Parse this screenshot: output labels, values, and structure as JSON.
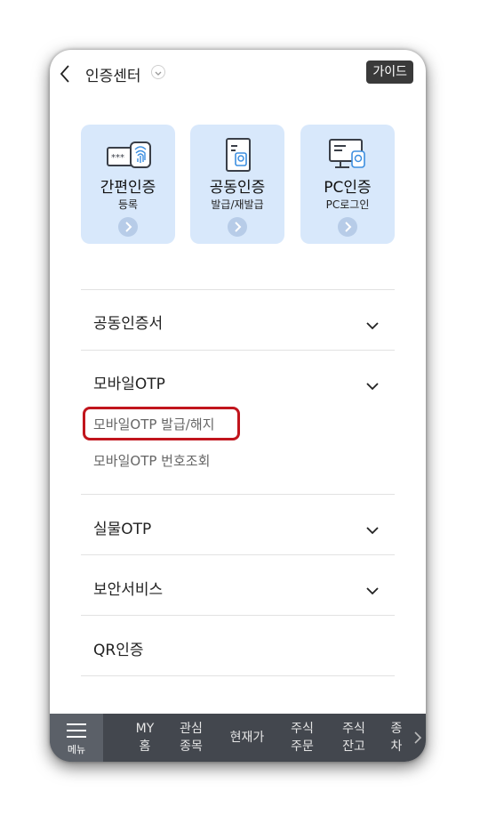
{
  "header": {
    "title": "인증센터",
    "guide_label": "가이드"
  },
  "cards": [
    {
      "name": "간편인증",
      "sub": "등록",
      "icon": "fingerprint-card-icon"
    },
    {
      "name": "공동인증",
      "sub": "발급/재발급",
      "icon": "certificate-document-icon"
    },
    {
      "name": "PC인증",
      "sub": "PC로그인",
      "icon": "pc-certificate-icon"
    }
  ],
  "accordion": [
    {
      "label": "공동인증서"
    },
    {
      "label": "모바일OTP",
      "children": [
        "모바일OTP 발급/해지",
        "모바일OTP 번호조회"
      ]
    },
    {
      "label": "실물OTP"
    },
    {
      "label": "보안서비스"
    },
    {
      "label": "QR인증"
    }
  ],
  "bottom_nav": {
    "menu_label": "메뉴",
    "tabs": [
      {
        "line1": "MY",
        "line2": "홈"
      },
      {
        "line1": "관심",
        "line2": "종목"
      },
      {
        "line1": "현재가",
        "line2": ""
      },
      {
        "line1": "주식",
        "line2": "주문"
      },
      {
        "line1": "주식",
        "line2": "잔고"
      },
      {
        "line1": "종",
        "line2": "차"
      }
    ]
  },
  "colors": {
    "card_bg": "#d8e8fb",
    "nav_bg": "#43474e",
    "highlight": "#c1151d"
  }
}
